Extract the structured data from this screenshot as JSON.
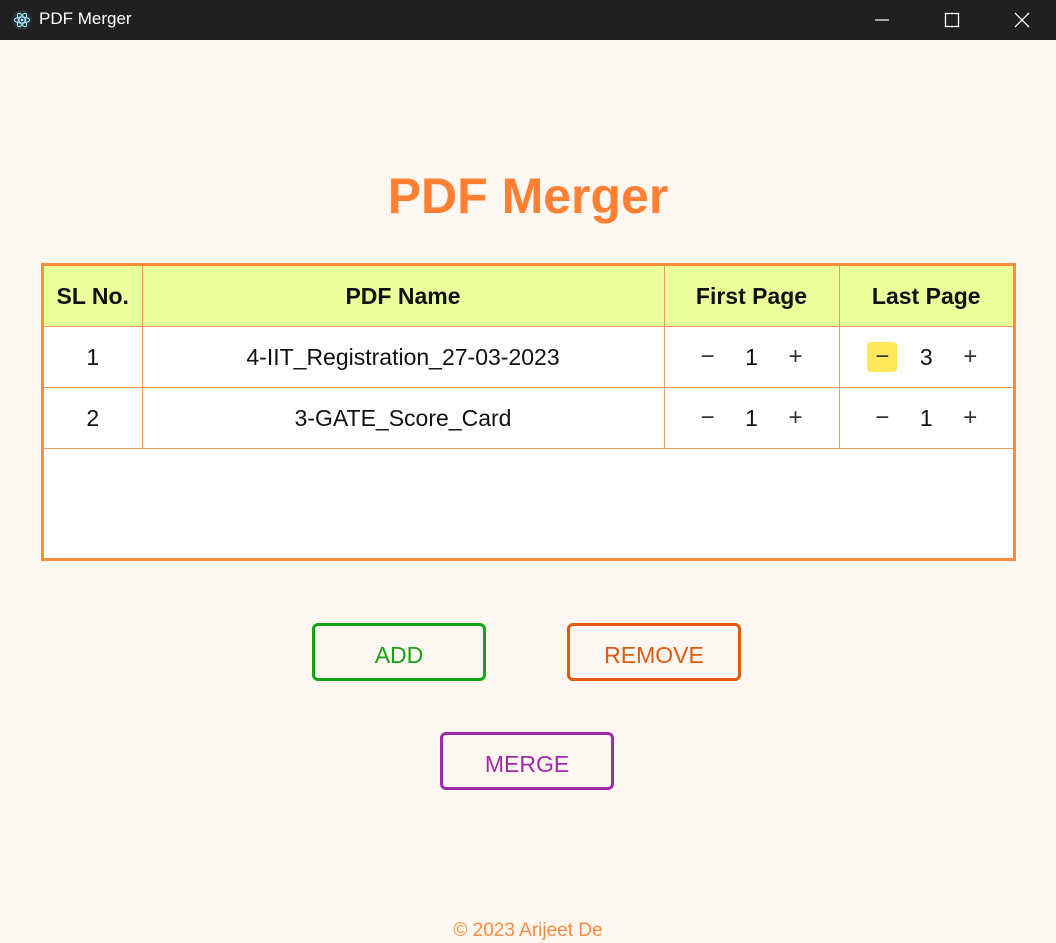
{
  "window": {
    "title": "PDF Merger",
    "icon": "electron-atom-icon"
  },
  "header": {
    "title": "PDF Merger"
  },
  "table": {
    "columns": [
      "SL No.",
      "PDF Name",
      "First Page",
      "Last Page"
    ],
    "rows": [
      {
        "sl": "1",
        "name": "4-IIT_Registration_27-03-2023",
        "first_page": "1",
        "last_page": "3"
      },
      {
        "sl": "2",
        "name": "3-GATE_Score_Card",
        "first_page": "1",
        "last_page": "1"
      }
    ],
    "stepper": {
      "minus": "−",
      "plus": "+"
    }
  },
  "buttons": {
    "add": "ADD",
    "remove": "REMOVE",
    "merge": "MERGE"
  },
  "footer": {
    "text": "© 2023 Arijeet De"
  },
  "colors": {
    "accent": "#ff7f33",
    "header_bg": "#eaff9a",
    "add": "#16a312",
    "remove": "#e05a0f",
    "merge": "#a12aa8",
    "highlight": "#ffe55a"
  }
}
